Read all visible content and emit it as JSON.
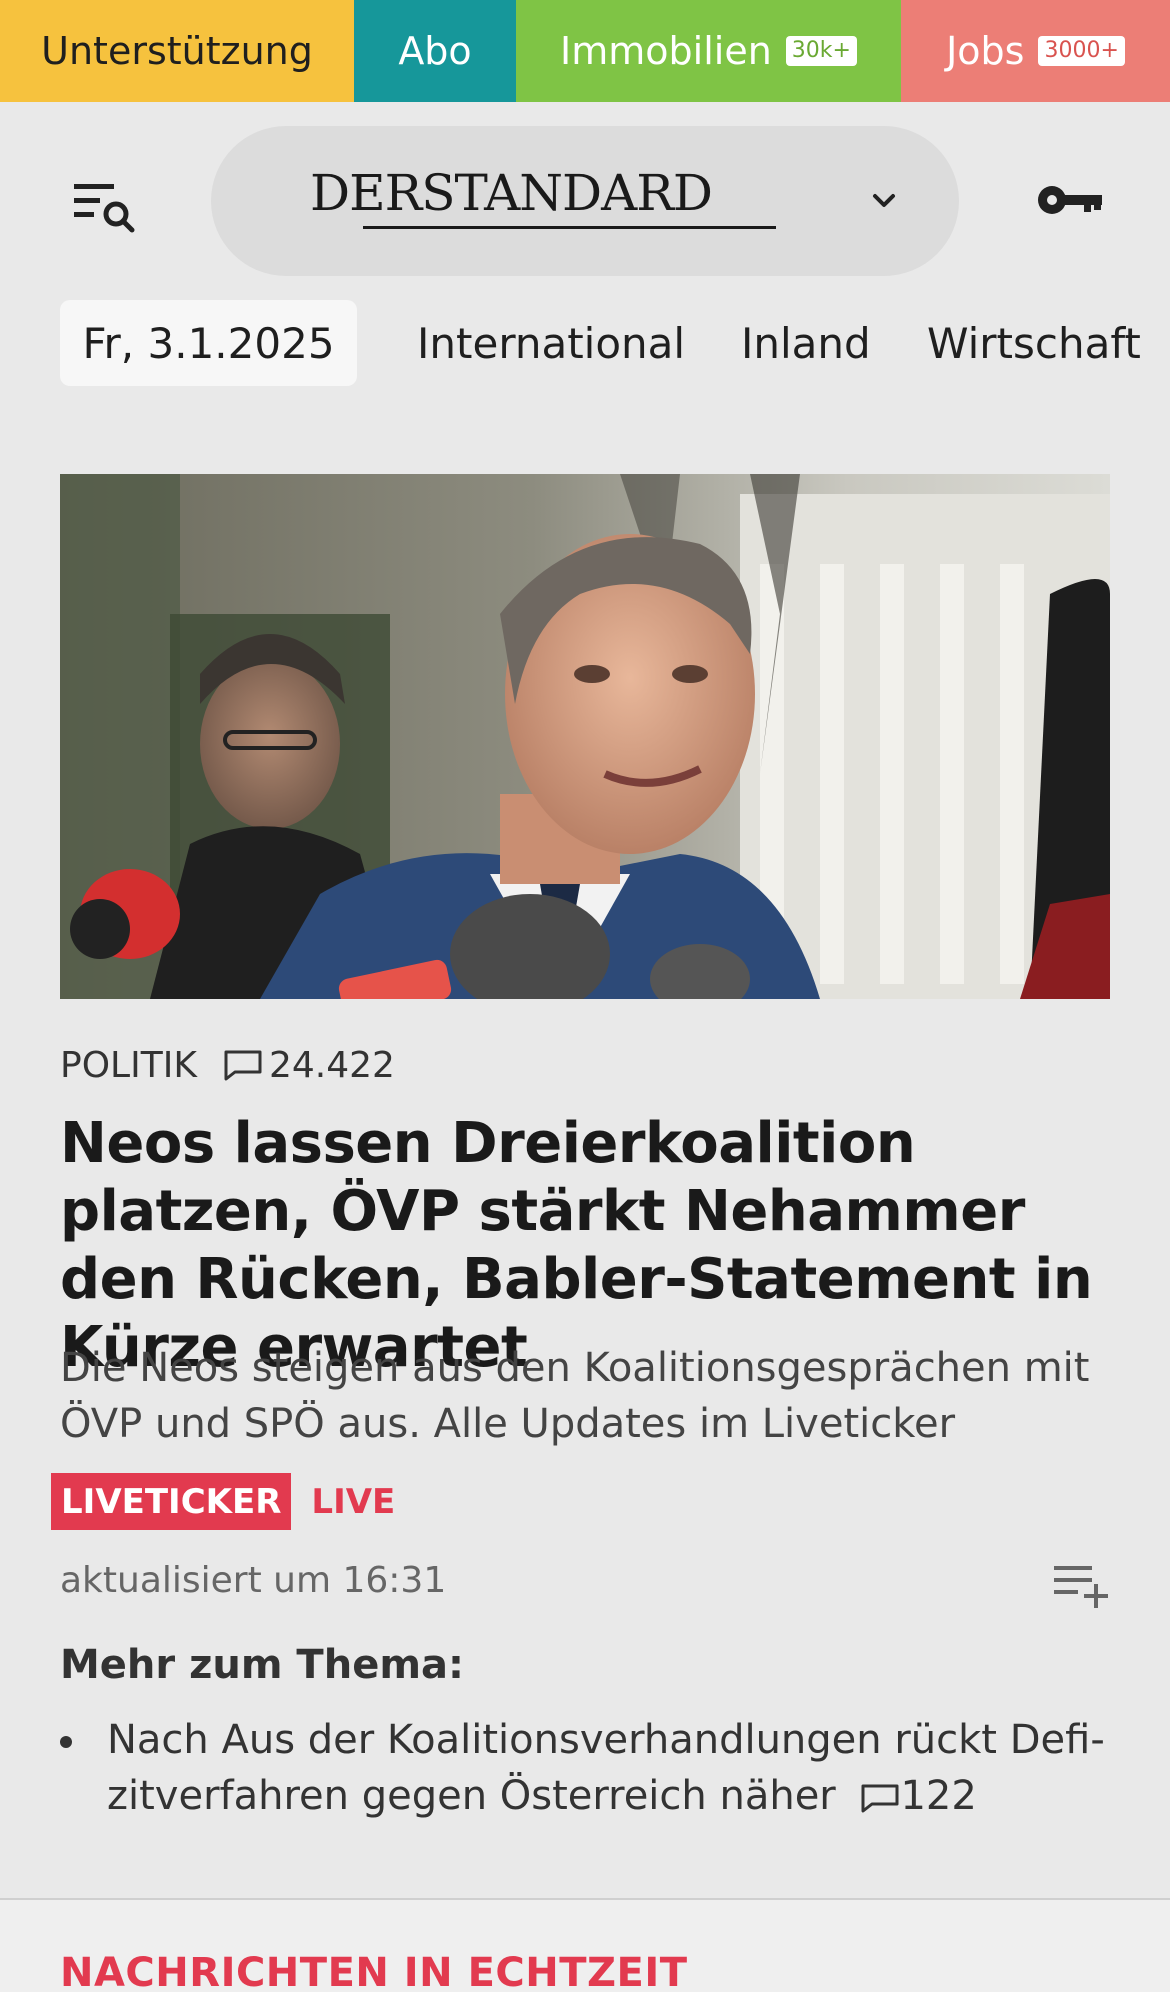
{
  "topbar": {
    "support_label": "Unterstützung",
    "abo_label": "Abo",
    "immobilien_label": "Immobilien",
    "immobilien_badge": "30k+",
    "jobs_label": "Jobs",
    "jobs_badge": "3000+"
  },
  "header": {
    "logo_text": "DERSTANDARD",
    "menu_icon": "menu-search-icon",
    "account_icon": "key-icon"
  },
  "nav": {
    "date": "Fr, 3.1.2025",
    "items": [
      "International",
      "Inland",
      "Wirtschaft"
    ]
  },
  "article": {
    "category": "POLITIK",
    "comment_count": "24.422",
    "headline": "Neos lassen Dreierkoalition platzen, ÖVP stärkt Nehammer den Rücken, Babler-Statement in Kürze erwartet",
    "teaser": "Die Neos steigen aus den Koalitionsgesprächen mit ÖVP und SPÖ aus. Alle Updates im Liveticker",
    "liveticker_tag": "LIVETICKER",
    "live_word": "LIVE",
    "updated": "aktualisiert um 16:31"
  },
  "more": {
    "title": "Mehr zum Thema:",
    "items": [
      {
        "text": "Nach Aus der Koalitionsverhandlungen rückt Defi­zitverfahren gegen Österreich näher",
        "comments": "122"
      }
    ]
  },
  "next_section": {
    "title": "NACHRICHTEN IN ECHTZEIT"
  },
  "colors": {
    "support": "#f6c23e",
    "abo": "#16979a",
    "immobilien": "#7fc445",
    "jobs": "#ec7e76",
    "live_red": "#e23a4f"
  }
}
